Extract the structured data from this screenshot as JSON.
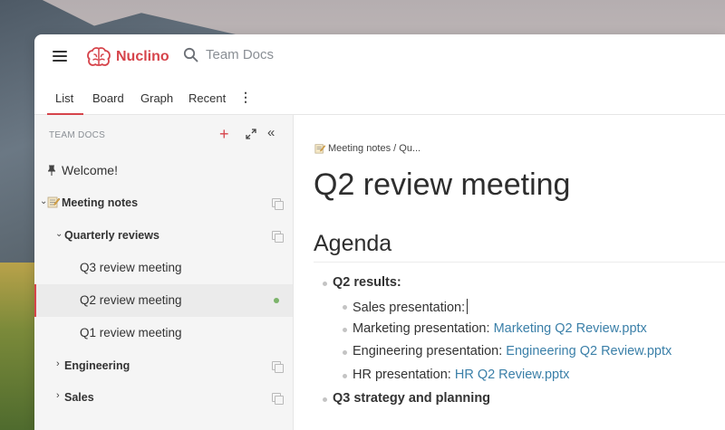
{
  "app": {
    "name": "Nuclino",
    "search_placeholder": "Team Docs",
    "brand_color": "#d6444b"
  },
  "tabs": [
    {
      "label": "List",
      "active": true
    },
    {
      "label": "Board",
      "active": false
    },
    {
      "label": "Graph",
      "active": false
    },
    {
      "label": "Recent",
      "active": false
    }
  ],
  "sidebar": {
    "header": "TEAM DOCS",
    "items": [
      {
        "label": "Welcome!",
        "icon": "pin-icon"
      },
      {
        "label": "Meeting notes",
        "icon": "memo-icon",
        "expanded": true
      },
      {
        "label": "Quarterly reviews",
        "expanded": true
      },
      {
        "label": "Q3 review meeting"
      },
      {
        "label": "Q2 review meeting",
        "selected": true
      },
      {
        "label": "Q1 review meeting"
      },
      {
        "label": "Engineering",
        "expanded": false
      },
      {
        "label": "Sales",
        "expanded": false
      }
    ]
  },
  "document": {
    "breadcrumb": "Meeting notes / Qu...",
    "title": "Q2 review meeting",
    "section_heading": "Agenda",
    "bullets": [
      {
        "text": "Q2 results:",
        "level": 1
      },
      {
        "text": "Sales presentation:",
        "level": 2
      },
      {
        "text": "Marketing presentation:",
        "link": "Marketing Q2 Review.pptx",
        "level": 2
      },
      {
        "text": "Engineering presentation:",
        "link": "Engineering Q2 Review.pptx",
        "level": 2
      },
      {
        "text": "HR presentation:",
        "link": "HR Q2 Review.pptx",
        "level": 2
      },
      {
        "text": "Q3 strategy and planning",
        "level": 1
      }
    ]
  }
}
